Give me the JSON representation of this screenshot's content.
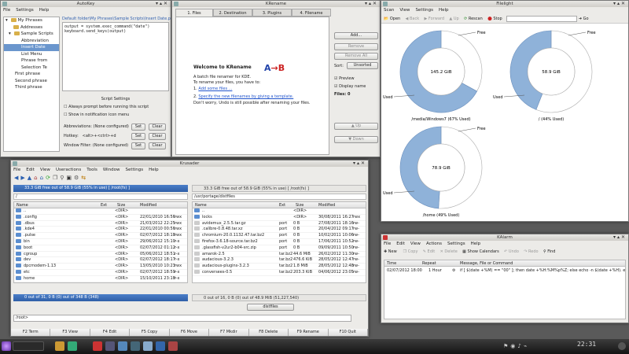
{
  "autokey": {
    "title": "AutoKey",
    "menu": [
      "File",
      "Settings",
      "Help"
    ],
    "tree": [
      "My Phrases",
      "Addresses",
      "Sample Scripts",
      "Abbreviation",
      "Insert Date",
      "List Menu",
      "Phrase from",
      "Selection Te",
      "First phrase",
      "Second phrase",
      "Third phrase"
    ],
    "path": "Default folder\\My Phrases\\Sample Scripts\\Insert Date.py",
    "code": [
      "output = system.exec_command(\"date\")",
      "keyboard.send_keys(output)"
    ],
    "settings_title": "Script Settings",
    "chk1": "Always prompt before running this script",
    "chk2": "Show in notification icon menu",
    "abbr_label": "Abbreviations:",
    "abbr_val": "(None configured)",
    "hotkey_label": "Hotkey:",
    "hotkey_val": "<alt>+<ctrl>+d",
    "filter_label": "Window Filter:",
    "filter_val": "(None configured)",
    "set": "Set",
    "clear": "Clear"
  },
  "krename": {
    "title": "KRename",
    "tabs": [
      "1. Files",
      "2. Destination",
      "3. Plugins",
      "4. Filename"
    ],
    "welcome": "Welcome to KRename",
    "line1": "A batch file renamer for KDE.",
    "line2": "To rename your files, you have to:",
    "link1": "Add some files ...",
    "link2": "Specify the new filenames by giving a template.",
    "line3": "Don't worry, Undo is still possible after renaming your files.",
    "add": "Add...",
    "remove": "Remove",
    "remove_all": "Remove All",
    "sort_label": "Sort:",
    "sort_val": "Unsorted",
    "preview": "Preview",
    "display": "Display name",
    "files": "Files: 0",
    "up": "Up",
    "down": "Down"
  },
  "filelight": {
    "title": "Filelight",
    "menu": [
      "Scan",
      "View",
      "Settings",
      "Help"
    ],
    "toolbar": [
      "Open",
      "Back",
      "Forward",
      "Up",
      "Rescan",
      "Stop",
      "Go"
    ],
    "charts": [
      {
        "label": "/media/Windows7 (67% Used)",
        "center": "145.2 GiB",
        "used": "Used",
        "free": "Free",
        "used_fraction": 0.67
      },
      {
        "label": "/ (44% Used)",
        "center": "58.9 GiB",
        "used": "Used",
        "free": "Free",
        "used_fraction": 0.44
      },
      {
        "label": "/home (49% Used)",
        "center": "78.9 GiB",
        "used": "Used",
        "free": "Free",
        "used_fraction": 0.49
      }
    ]
  },
  "krusader": {
    "title": "Krusader",
    "menu": [
      "File",
      "Edit",
      "View",
      "Useractions",
      "Tools",
      "Window",
      "Settings",
      "Help"
    ],
    "left_bar": "33.3 GiB free out of 58.9 GiB (55% in use) [ /root(fs) ]",
    "right_bar": "33.3 GiB free out of 58.9 GiB (55% in use) [ /root(fs) ]",
    "left_path": "/",
    "right_path": "/usr/portage/distfiles",
    "cols": [
      "Name",
      "Ext",
      "Size",
      "Modified",
      "rwx"
    ],
    "left_rows": [
      [
        "..",
        "",
        "<DIR>",
        "",
        ""
      ],
      [
        ".config",
        "",
        "<DIR>",
        "22/01/2010 16:56",
        "rwx"
      ],
      [
        ".dbus",
        "",
        "<DIR>",
        "21/03/2012 22:25",
        "rwx"
      ],
      [
        ".kde4",
        "",
        "<DIR>",
        "22/01/2010 00:56",
        "rwx"
      ],
      [
        ".pulse",
        "",
        "<DIR>",
        "02/07/2012 18:18",
        "rwx"
      ],
      [
        "bin",
        "",
        "<DIR>",
        "29/06/2012 15:10",
        "r-x"
      ],
      [
        "boot",
        "",
        "<DIR>",
        "02/07/2012 01:12",
        "r-x"
      ],
      [
        "cgroup",
        "",
        "<DIR>",
        "05/06/2012 18:51",
        "r-x"
      ],
      [
        "dev",
        "",
        "<DIR>",
        "02/07/2012 18:17",
        "r-x"
      ],
      [
        "dpcmodem-1.13",
        "",
        "<DIR>",
        "13/05/2010 10:23",
        "rwx"
      ],
      [
        "etc",
        "",
        "<DIR>",
        "02/07/2012 18:59",
        "r-x"
      ],
      [
        "home",
        "",
        "<DIR>",
        "15/10/2011 23:18",
        "r-x"
      ]
    ],
    "right_rows": [
      [
        "..",
        "",
        "<DIR>",
        "",
        ""
      ],
      [
        "locks",
        "",
        "<DIR>",
        "30/08/2011 16:27",
        "rwx"
      ],
      [
        "avidemux_2.5.5.tar.gz",
        "port",
        "0 B",
        "27/08/2011 18:16",
        "rw-"
      ],
      [
        ".calibre-0.8.48.tar.xz",
        "port",
        "0 B",
        "20/04/2012 09:17",
        "rw-"
      ],
      [
        "chromium-20.0.1132.47.tar.bz2",
        "port",
        "0 B",
        "10/02/2011 10:06",
        "rw-"
      ],
      [
        "firefox-3.6.18-source.tar.bz2",
        "port",
        "0 B",
        "17/06/2011 10:52",
        "rw-"
      ],
      [
        ".glassfish-v2ur2-b04-src.zip",
        "port",
        "0 B",
        "09/09/2011 10:50",
        "rw-"
      ],
      [
        "amarok-2.5",
        "tar.bz2",
        "44.6 MiB",
        "26/02/2012 11:30",
        "rw-"
      ],
      [
        "audacious-3.2.3",
        "tar.bz2",
        "476.6 KiB",
        "28/05/2012 12:47",
        "rw-"
      ],
      [
        "audacious-plugins-3.2.3",
        "tar.bz2",
        "1.8 MiB",
        "28/05/2012 12:48",
        "rw-"
      ],
      [
        "conversees-0.5",
        "tar.bz2",
        "203.3 KiB",
        "04/06/2012 23:05",
        "rw-"
      ]
    ],
    "left_status": "0 out of 31, 0 B (0) out of 348 B (348)",
    "right_status": "0 out of 16, 0 B (0) out of 48.9 MiB (51,227,540)",
    "right_tab": "distfiles",
    "cmd": "/root>",
    "fkeys": [
      "F2 Term",
      "F3 View",
      "F4 Edit",
      "F5 Copy",
      "F6 Move",
      "F7 Mkdir",
      "F8 Delete",
      "F9 Rename",
      "F10 Quit"
    ]
  },
  "kalarm": {
    "title": "KAlarm",
    "menu": [
      "File",
      "Edit",
      "View",
      "Actions",
      "Settings",
      "Help"
    ],
    "toolbar": [
      "New",
      "Copy",
      "Edit",
      "Delete",
      "Show Calendars",
      "Undo",
      "Redo",
      "Find"
    ],
    "cols": [
      "Time",
      "Repeat",
      "Message, File or Command"
    ],
    "row": {
      "time": "02/07/2012 18:00",
      "repeat": "1 Hour",
      "msg": "if [ $(date +%M) == \"00\" ]; then date +%H:%M%p%Z; else echo -n $(date +%H). ech"
    }
  },
  "clock": "22:31"
}
